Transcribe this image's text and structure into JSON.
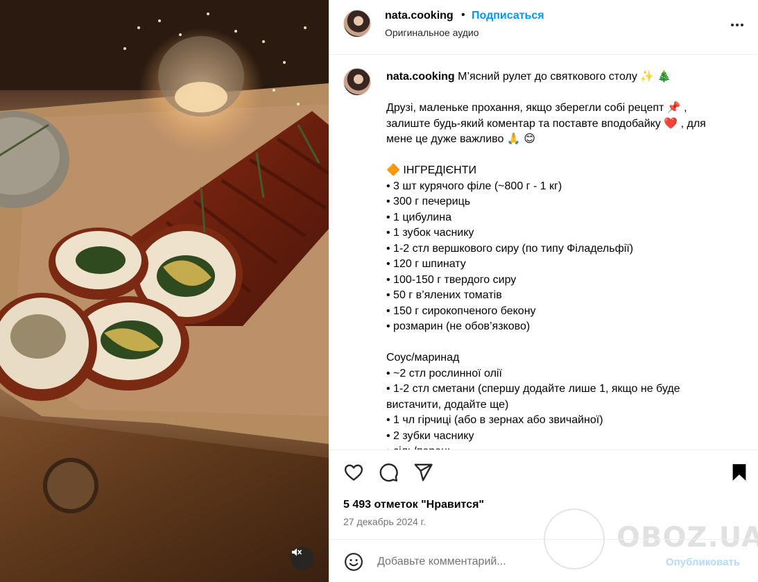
{
  "post": {
    "username": "nata.cooking",
    "separator": "•",
    "follow_label": "Подписаться",
    "audio_label": "Оригинальное аудио"
  },
  "caption": {
    "title": "М’ясний рулет до святкового столу ✨ 🎄",
    "lines": [
      "Друзі, маленьке прохання, якщо зберегли собі рецепт 📌 ,",
      "залиште будь-який коментар та поставте вподобайку ❤️ , для",
      "мене це дуже важливо 🙏 😊",
      "",
      "🔶 ІНГРЕДІЄНТИ",
      "• 3 шт курячого філе (~800 г - 1 кг)",
      "• 300 г печериць",
      "• 1 цибулина",
      "• 1 зубок часнику",
      "• 1-2 стл вершкового сиру (по типу Філадельфії)",
      "• 120 г шпинату",
      "• 100-150 г твердого сиру",
      "• 50 г в’ялених томатів",
      "• 150 г сирокопченого бекону",
      "• розмарин (не обов’язково)",
      "",
      "Соус/маринад",
      "• ~2 стл рослинної олії",
      "• 1-2 стл сметани (спершу додайте лише 1, якщо не буде",
      "вистачити, додайте ще)",
      "• 1 чл гірчиці (або в зернах або звичайної)",
      "• 2 зубки часнику",
      "• сіль/перець"
    ]
  },
  "stats": {
    "likes": "5 493 отметок \"Нравится\"",
    "date": "27 декабрь 2024 г."
  },
  "comment": {
    "placeholder": "Добавьте комментарий...",
    "publish_label": "Опубликовать"
  },
  "watermark": {
    "text": "OBOZ.UA"
  },
  "icons": {
    "more": "more-horizontal-icon",
    "like": "heart-icon",
    "comment": "comment-icon",
    "share": "send-icon",
    "save": "bookmark-icon",
    "emoji": "emoji-icon",
    "mute": "speaker-muted-icon"
  },
  "colors": {
    "accent": "#0095f6",
    "publish_disabled": "#b3dbff",
    "secondary_text": "#737373",
    "divider": "#efefef"
  }
}
